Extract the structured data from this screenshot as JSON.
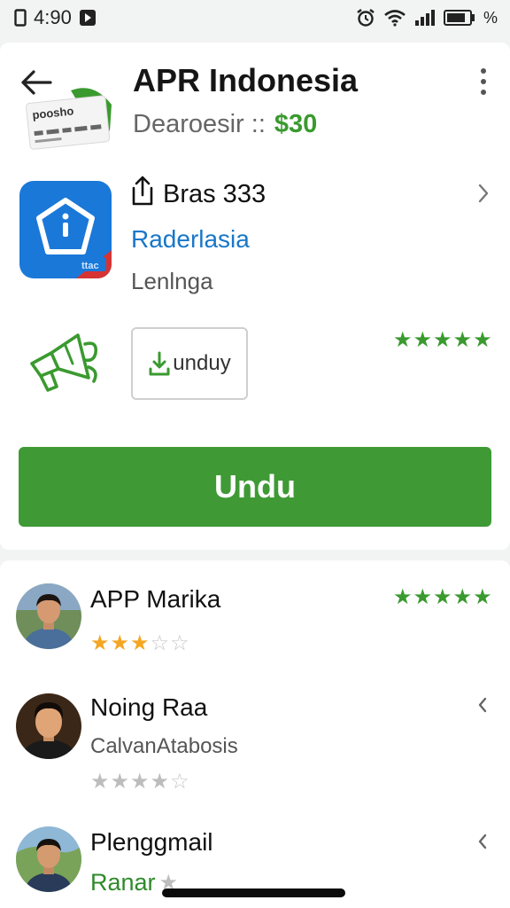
{
  "status_bar": {
    "time": "4:90",
    "battery": "%",
    "icons": [
      "sim-icon",
      "media-icon",
      "alarm-icon",
      "wifi-icon",
      "signal-icon",
      "battery-icon"
    ]
  },
  "header": {
    "title": "APR Indonesia",
    "subtitle": "Dearoesir ::",
    "price": "$30",
    "thumbnail_text": "poosho"
  },
  "app_tile": {
    "title": "Bras 333",
    "link": "Raderlasia",
    "sub": "Lenlnga"
  },
  "secondary": {
    "button_label": "unduy",
    "rating": 5
  },
  "primary_button": {
    "label": "Undu"
  },
  "reviews": [
    {
      "name": "APP Marika",
      "line": "",
      "link": "",
      "stars": 3,
      "stars_max": 5,
      "top_rating": 5
    },
    {
      "name": "Noing Raa",
      "line": "CalvanAtabosis",
      "link": "",
      "stars": 4,
      "stars_max": 5,
      "top_rating": null
    },
    {
      "name": "Plenggmail",
      "line": "",
      "link": "Ranar",
      "stars": 1,
      "stars_max": 1,
      "top_rating": null
    }
  ],
  "colors": {
    "green": "#3f9a35",
    "blue": "#1a78d8",
    "link_blue": "#1877c9",
    "star_orange": "#f5a623",
    "background": "#f2f3f3"
  }
}
